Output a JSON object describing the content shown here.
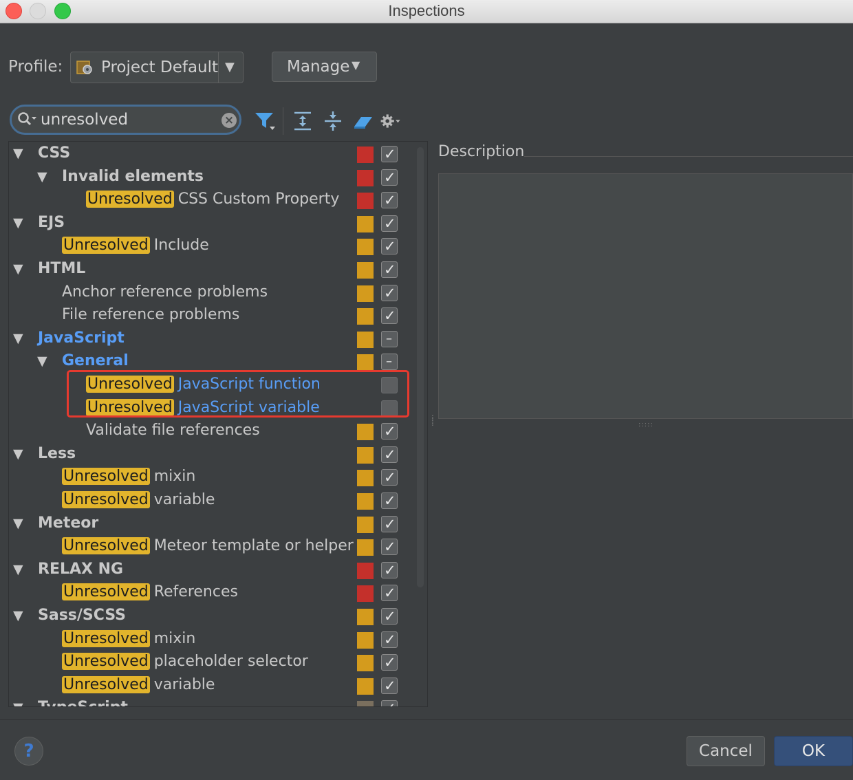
{
  "window": {
    "title": "Inspections"
  },
  "profile": {
    "label": "Profile:",
    "value": "Project Default",
    "manage_label": "Manage"
  },
  "search": {
    "value": "unresolved",
    "highlight": "Unresolved"
  },
  "description": {
    "label": "Description"
  },
  "colors": {
    "error": "#c4302b",
    "warning": "#d49b1d",
    "highlight": "#e2b42c",
    "selected_text": "#589df6"
  },
  "tree": [
    {
      "level": 0,
      "expand": true,
      "label": "CSS",
      "bold": true,
      "severity": "error",
      "check": "on"
    },
    {
      "level": 1,
      "expand": true,
      "label": "Invalid elements",
      "bold": true,
      "severity": "error",
      "check": "on"
    },
    {
      "level": 2,
      "hl": true,
      "label": "CSS Custom Property",
      "severity": "error",
      "check": "on"
    },
    {
      "level": 0,
      "expand": true,
      "label": "EJS",
      "bold": true,
      "severity": "warning",
      "check": "on"
    },
    {
      "level": 1,
      "hl": true,
      "label": "Include",
      "severity": "warning",
      "check": "on"
    },
    {
      "level": 0,
      "expand": true,
      "label": "HTML",
      "bold": true,
      "severity": "warning",
      "check": "on"
    },
    {
      "level": 1,
      "label": "Anchor reference problems",
      "severity": "warning",
      "check": "on"
    },
    {
      "level": 1,
      "label": "File reference problems",
      "severity": "warning",
      "check": "on"
    },
    {
      "level": 0,
      "expand": true,
      "label": "JavaScript",
      "bold": true,
      "blue": true,
      "severity": "warning",
      "check": "partial"
    },
    {
      "level": 1,
      "expand": true,
      "label": "General",
      "bold": true,
      "blue": true,
      "severity": "warning",
      "check": "partial"
    },
    {
      "level": 2,
      "hl": true,
      "label": "JavaScript function",
      "blue": true,
      "severity": "none",
      "check": "off"
    },
    {
      "level": 2,
      "hl": true,
      "label": "JavaScript variable",
      "blue": true,
      "severity": "none",
      "check": "off"
    },
    {
      "level": 2,
      "label": "Validate file references",
      "severity": "warning",
      "check": "on"
    },
    {
      "level": 0,
      "expand": true,
      "label": "Less",
      "bold": true,
      "severity": "warning",
      "check": "on"
    },
    {
      "level": 1,
      "hl": true,
      "label": "mixin",
      "severity": "warning",
      "check": "on"
    },
    {
      "level": 1,
      "hl": true,
      "label": "variable",
      "severity": "warning",
      "check": "on"
    },
    {
      "level": 0,
      "expand": true,
      "label": "Meteor",
      "bold": true,
      "severity": "warning",
      "check": "on"
    },
    {
      "level": 1,
      "hl": true,
      "label": "Meteor template or helper",
      "severity": "warning",
      "check": "on"
    },
    {
      "level": 0,
      "expand": true,
      "label": "RELAX NG",
      "bold": true,
      "severity": "error",
      "check": "on"
    },
    {
      "level": 1,
      "hl": true,
      "label": "References",
      "severity": "error",
      "check": "on"
    },
    {
      "level": 0,
      "expand": true,
      "label": "Sass/SCSS",
      "bold": true,
      "severity": "warning",
      "check": "on"
    },
    {
      "level": 1,
      "hl": true,
      "label": "mixin",
      "severity": "warning",
      "check": "on"
    },
    {
      "level": 1,
      "hl": true,
      "label": "placeholder selector",
      "severity": "warning",
      "check": "on"
    },
    {
      "level": 1,
      "hl": true,
      "label": "variable",
      "severity": "warning",
      "check": "on"
    },
    {
      "level": 0,
      "expand": true,
      "label": "TypeScript",
      "bold": true,
      "severity": "gray",
      "check": "on"
    }
  ],
  "buttons": {
    "cancel": "Cancel",
    "ok": "OK",
    "help": "?"
  }
}
